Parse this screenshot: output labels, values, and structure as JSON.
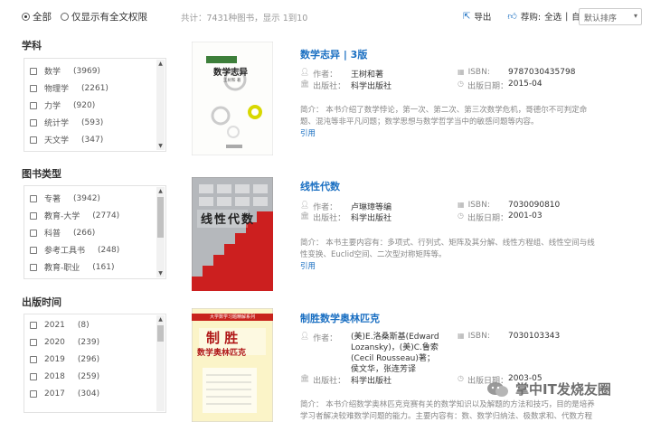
{
  "filters": {
    "all_label": "全部",
    "fulltext_label": "仅显示有全文权限"
  },
  "stats_text": "共计：7431种图书，显示 1到10",
  "tools": {
    "export_label": "导出",
    "recommend_label": "荐购:",
    "select_all_label": "全选",
    "separator": "|",
    "invert_label": "自选"
  },
  "sort": {
    "selected": "默认排序"
  },
  "facets": {
    "subject": {
      "title": "学科",
      "items": [
        {
          "label": "数学",
          "count": "(3969)"
        },
        {
          "label": "物理学",
          "count": "(2261)"
        },
        {
          "label": "力学",
          "count": "(920)"
        },
        {
          "label": "统计学",
          "count": "(593)"
        },
        {
          "label": "天文学",
          "count": "(347)"
        }
      ]
    },
    "type": {
      "title": "图书类型",
      "items": [
        {
          "label": "专著",
          "count": "(3942)"
        },
        {
          "label": "教育-大学",
          "count": "(2774)"
        },
        {
          "label": "科普",
          "count": "(266)"
        },
        {
          "label": "参考工具书",
          "count": "(248)"
        },
        {
          "label": "教育-职业",
          "count": "(161)"
        }
      ]
    },
    "year": {
      "title": "出版时间",
      "items": [
        {
          "label": "2021",
          "count": "(8)"
        },
        {
          "label": "2020",
          "count": "(239)"
        },
        {
          "label": "2019",
          "count": "(296)"
        },
        {
          "label": "2018",
          "count": "(259)"
        },
        {
          "label": "2017",
          "count": "(304)"
        }
      ]
    }
  },
  "labels": {
    "author": "作者：",
    "isbn": "ISBN:",
    "publisher": "出版社：",
    "pubdate": "出版日期：",
    "cite": "引用"
  },
  "books": [
    {
      "title": "数学志异 | 3版",
      "author": "王树和著",
      "isbn": "9787030435798",
      "publisher": "科学出版社",
      "pubdate": "2015-04",
      "summary": "简介：  本书介绍了数学悖论，第一次、第二次、第三次数学危机，哥德尔不可判定命题、混沌等非平凡问题；数学思想与数学哲学当中的敏感问题等内容。",
      "cover_title": "数学志异",
      "cover_author": "王树和 著"
    },
    {
      "title": "线性代数",
      "author": "卢琳璋等编",
      "isbn": "7030090810",
      "publisher": "科学出版社",
      "pubdate": "2001-03",
      "summary": "简介：  本书主要内容有：多项式、行列式、矩阵及其分解、线性方程组、线性空间与线性变换、Euclid空间、二次型对称矩阵等。",
      "cover_title": "线性代数"
    },
    {
      "title": "制胜数学奥林匹克",
      "author": "(美)E.洛桑斯基(Edward Lozansky)，(美)C.鲁索(Cecil Rousseau)著；侯文华，张连芳译",
      "isbn": "7030103343",
      "publisher": "科学出版社",
      "pubdate": "2003-05",
      "summary": "简介：  本书介绍数学奥林匹克竞赛有关的数学知识以及解题的方法和技巧，目的是培养学习者解决较难数学问题的能力。主要内容有：数、数学归纳法、极数求和、代数方程等。",
      "cover_series": "大学数学习题精解系列",
      "cover_title1": "制  胜",
      "cover_title2": "数学奥林匹克"
    }
  ],
  "watermark": "掌中IT发烧友圈"
}
